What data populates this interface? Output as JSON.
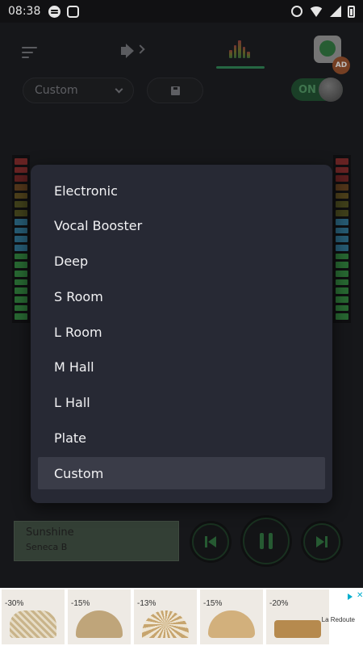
{
  "status_bar": {
    "time": "08:38",
    "left_icons": [
      "spotify-icon",
      "pinwheel-icon"
    ],
    "right_icons": [
      "alarm-icon",
      "wifi-icon",
      "signal-icon",
      "battery-icon"
    ]
  },
  "header": {
    "icons": [
      "menu-icon",
      "volume-icon",
      "equalizer-icon",
      "download-app-icon"
    ],
    "ad_badge": "AD",
    "active_tab_color": "#2d7a4f"
  },
  "controls": {
    "preset_select_value": "Custom",
    "toggle_label": "ON"
  },
  "meters": {
    "colors": [
      "#7a2a2a",
      "#7a2a2a",
      "#6a2424",
      "#5e3f1f",
      "#5a4a1f",
      "#4a4a1f",
      "#4a4a1f",
      "#2d6a86",
      "#2d6a86",
      "#2d6a86",
      "#2d6a86",
      "#2e7a3a",
      "#2e7a3a",
      "#2e7a3a",
      "#2e7a3a",
      "#2e7a3a",
      "#2e7a3a",
      "#2e7a3a",
      "#2e7a3a"
    ]
  },
  "preset_dialog": {
    "options": [
      {
        "label": "Electronic",
        "selected": false
      },
      {
        "label": "Vocal Booster",
        "selected": false
      },
      {
        "label": "Deep",
        "selected": false
      },
      {
        "label": "S Room",
        "selected": false
      },
      {
        "label": "L Room",
        "selected": false
      },
      {
        "label": "M Hall",
        "selected": false
      },
      {
        "label": "L Hall",
        "selected": false
      },
      {
        "label": "Plate",
        "selected": false
      },
      {
        "label": "Custom",
        "selected": true
      }
    ]
  },
  "player": {
    "title": "Sunshine",
    "artist": "Seneca B",
    "controls": [
      "previous-icon",
      "pause-icon",
      "next-icon"
    ]
  },
  "ad_banner": {
    "tiles": [
      {
        "discount": "-30%"
      },
      {
        "discount": "-15%"
      },
      {
        "discount": "-13%"
      },
      {
        "discount": "-15%"
      },
      {
        "discount": "-20%"
      }
    ],
    "brand": "La Redoute"
  }
}
